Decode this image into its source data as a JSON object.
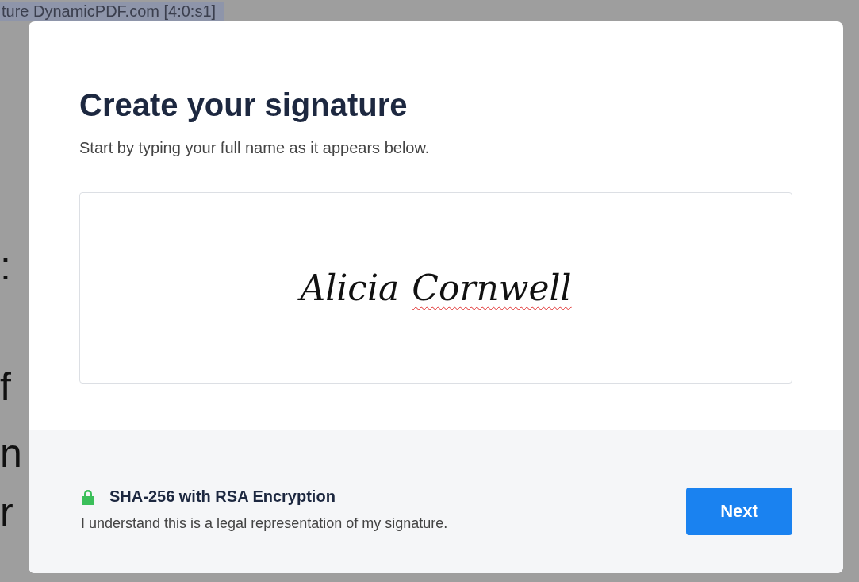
{
  "background_document": {
    "header_text": "ture DynamicPDF.com [4:0:s1]",
    "left_fragments": [
      ":",
      "f",
      "n",
      "r"
    ]
  },
  "dialog": {
    "title": "Create your signature",
    "subtitle": "Start by typing your full name as it appears below.",
    "signature_field": {
      "value_parts": [
        {
          "text": "Alicia",
          "misspelled": false
        },
        {
          "text": "Cornwell",
          "misspelled": true
        }
      ]
    },
    "footer": {
      "security_label": "SHA-256 with RSA Encryption",
      "notice": "I understand this is a legal representation of my signature.",
      "button": "Next"
    }
  }
}
